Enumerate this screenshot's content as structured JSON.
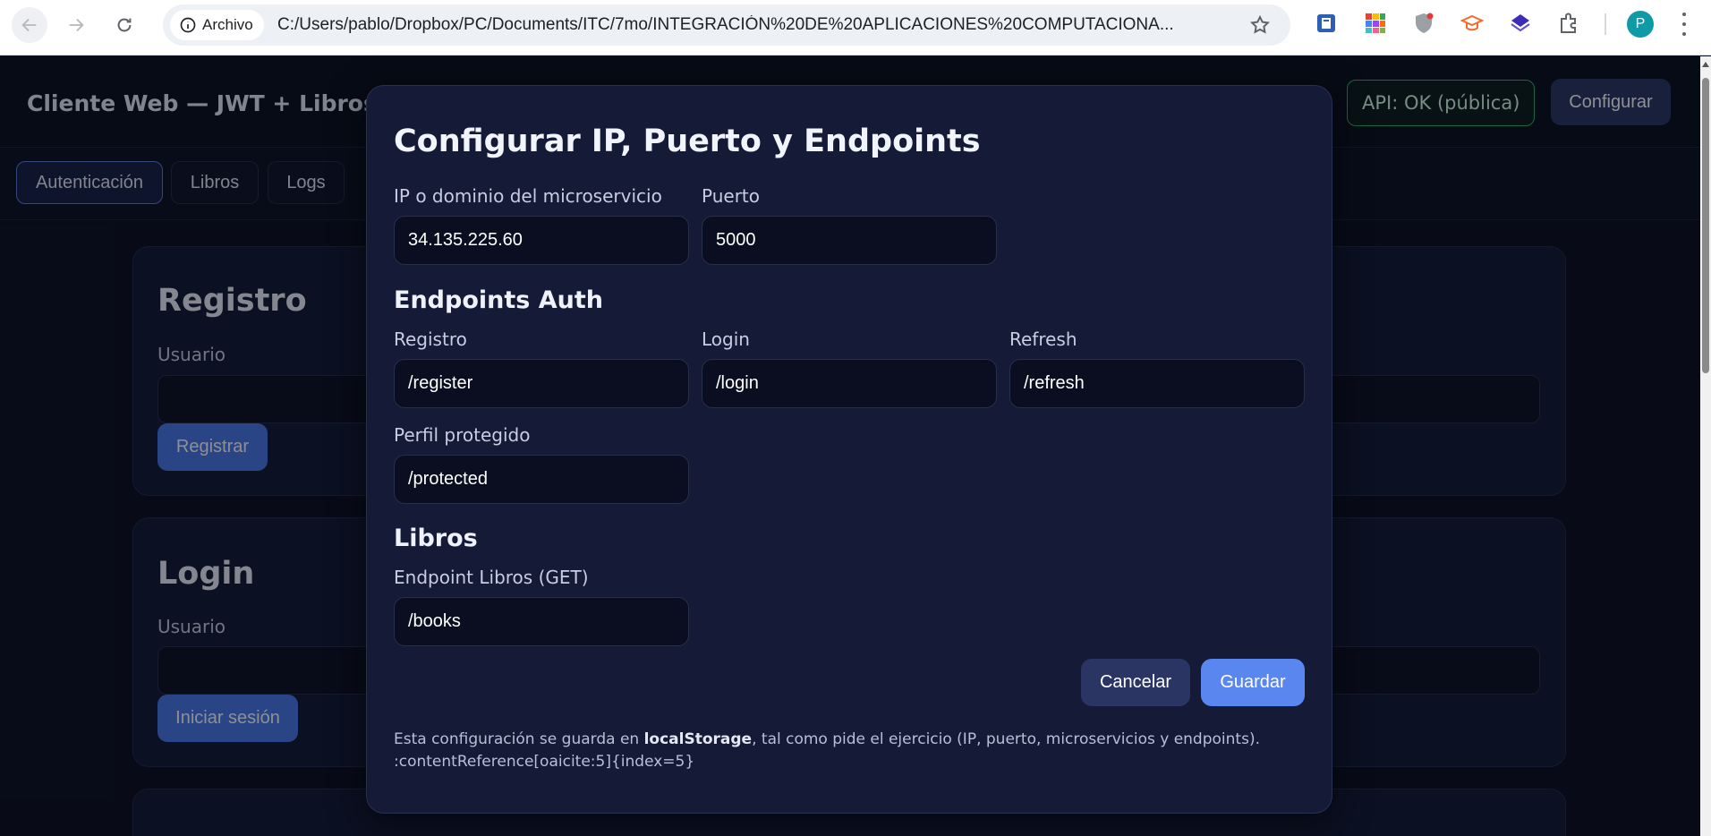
{
  "browser": {
    "site_chip": "Archivo",
    "url": "C:/Users/pablo/Dropbox/PC/Documents/ITC/7mo/INTEGRACIÓN%20DE%20APLICACIONES%20COMPUTACIONA...",
    "profile_initial": "P"
  },
  "header": {
    "title": "Cliente Web — JWT + Libros",
    "api_status": "API: OK (pública)",
    "config_button": "Configurar"
  },
  "tabs": [
    {
      "label": "Autenticación",
      "active": true
    },
    {
      "label": "Libros",
      "active": false
    },
    {
      "label": "Logs",
      "active": false
    }
  ],
  "cards": {
    "registro": {
      "title": "Registro",
      "user_label": "Usuario",
      "button": "Registrar"
    },
    "login": {
      "title": "Login",
      "user_label": "Usuario",
      "button": "Iniciar sesión"
    }
  },
  "modal": {
    "title": "Configurar IP, Puerto y Endpoints",
    "ip_label": "IP o dominio del microservicio",
    "ip_value": "34.135.225.60",
    "port_label": "Puerto",
    "port_value": "5000",
    "auth_section": "Endpoints Auth",
    "register_label": "Registro",
    "register_value": "/register",
    "login_label": "Login",
    "login_value": "/login",
    "refresh_label": "Refresh",
    "refresh_value": "/refresh",
    "protected_label": "Perfil protegido",
    "protected_value": "/protected",
    "books_section": "Libros",
    "books_label": "Endpoint Libros (GET)",
    "books_value": "/books",
    "cancel_button": "Cancelar",
    "save_button": "Guardar",
    "note_prefix": "Esta configuración se guarda en ",
    "note_bold": "localStorage",
    "note_suffix": ", tal como pide el ejercicio (IP, puerto, microservicios y endpoints).",
    "note_reference": ":contentReference[oaicite:5]{index=5}"
  },
  "colors": {
    "api_ok_border": "#2fb36c",
    "primary_button": "#5a86f0",
    "secondary_button": "#2b3563"
  }
}
